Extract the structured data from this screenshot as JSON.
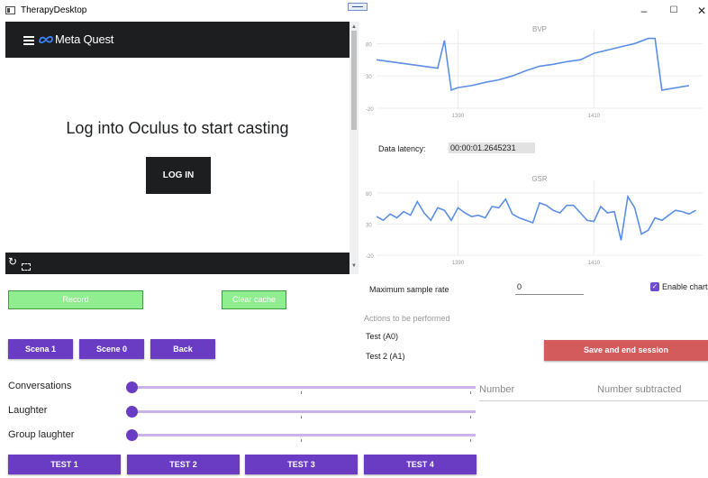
{
  "window": {
    "title": "TherapyDesktop",
    "minimize": "–",
    "maximize": "☐",
    "close": "✕"
  },
  "webview": {
    "brand": "Meta Quest",
    "heading": "Log into Oculus to start casting",
    "login_label": "LOG IN"
  },
  "charts": {
    "bvp_title": "BVP",
    "gsr_title": "GSR",
    "latency_label": "Data latency:",
    "latency_value": "00:00:01.2645231"
  },
  "chart_data": [
    {
      "type": "line",
      "title": "BVP",
      "x_ticks": [
        1390,
        1410
      ],
      "y_ticks": [
        80,
        30,
        -20
      ],
      "ylim": [
        -20,
        100
      ],
      "xlim": [
        1378,
        1426
      ],
      "series": [
        {
          "color": "#5b8fe6",
          "x": [
            1378,
            1387,
            1388,
            1389,
            1390,
            1392,
            1394,
            1396,
            1398,
            1400,
            1402,
            1404,
            1406,
            1408,
            1410,
            1412,
            1414,
            1416,
            1418,
            1419,
            1420,
            1424
          ],
          "y": [
            55,
            42,
            85,
            8,
            12,
            15,
            20,
            24,
            30,
            38,
            45,
            48,
            52,
            55,
            65,
            70,
            75,
            80,
            88,
            88,
            8,
            15
          ]
        }
      ]
    },
    {
      "type": "line",
      "title": "GSR",
      "x_ticks": [
        1390,
        1410
      ],
      "y_ticks": [
        80,
        30,
        -20
      ],
      "ylim": [
        -20,
        100
      ],
      "xlim": [
        1378,
        1426
      ],
      "series": [
        {
          "color": "#5b8fe6",
          "x": [
            1378,
            1379,
            1380,
            1381,
            1382,
            1383,
            1384,
            1385,
            1386,
            1387,
            1388,
            1389,
            1390,
            1391,
            1392,
            1393,
            1394,
            1395,
            1396,
            1397,
            1398,
            1399,
            1400,
            1401,
            1402,
            1403,
            1404,
            1405,
            1406,
            1407,
            1408,
            1409,
            1410,
            1411,
            1412,
            1413,
            1414,
            1415,
            1416,
            1417,
            1418,
            1419,
            1420,
            1421,
            1422,
            1423,
            1424,
            1425
          ],
          "y": [
            42,
            36,
            46,
            40,
            50,
            44,
            66,
            48,
            36,
            56,
            52,
            36,
            56,
            48,
            42,
            44,
            40,
            58,
            56,
            70,
            46,
            40,
            36,
            32,
            64,
            60,
            52,
            48,
            60,
            60,
            48,
            36,
            34,
            58,
            48,
            50,
            4,
            74,
            56,
            14,
            20,
            40,
            36,
            44,
            52,
            50,
            46,
            52
          ]
        }
      ]
    }
  ],
  "controls": {
    "sample_rate_label": "Maximum sample rate",
    "sample_rate_value": "0",
    "enable_charts_label": "Enable charts",
    "enable_charts_checked": true,
    "actions_title": "Actions to be performed",
    "action_items": [
      "Test (A0)",
      "Test 2 (A1)"
    ],
    "save_label": "Save and end session",
    "number_header": "Number",
    "number_subtracted_header": "Number subtracted"
  },
  "left_controls": {
    "record_label": "Record",
    "clear_label": "Clear cache",
    "scene_buttons": [
      "Scena 1",
      "Scene 0",
      "Back"
    ],
    "sliders": [
      {
        "label": "Conversations",
        "value": 0
      },
      {
        "label": "Laughter",
        "value": 0
      },
      {
        "label": "Group laughter",
        "value": 0
      }
    ],
    "test_buttons": [
      "TEST 1",
      "TEST 2",
      "TEST 3",
      "TEST 4"
    ]
  },
  "colors": {
    "accent": "#6a3cc4",
    "record_green": "#90ee90",
    "danger": "#d45b5b",
    "line": "#5b8fe6",
    "header_dark": "#1c1e20"
  }
}
